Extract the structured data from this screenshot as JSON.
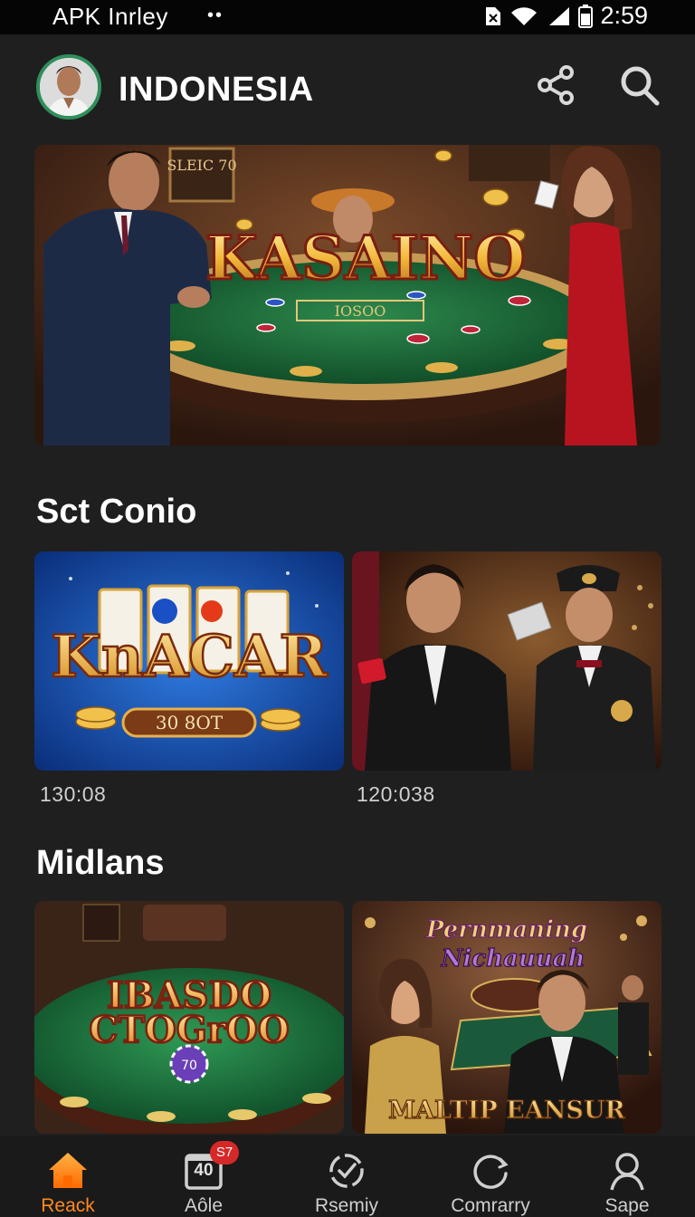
{
  "status_bar": {
    "app_label": "APK Inrley",
    "dots": "••",
    "time": "2:59",
    "icons": [
      "sim-icon",
      "wifi-icon",
      "signal-icon",
      "battery-icon"
    ]
  },
  "header": {
    "title": "INDONESIA",
    "icons": [
      "avatar",
      "share-icon",
      "search-icon"
    ]
  },
  "hero": {
    "logo_text": "KASAINO",
    "table_text": "IOSOO",
    "wall_sign": "SLEIC 70"
  },
  "sections": [
    {
      "title": "Sct Conio",
      "cards": [
        {
          "title_text": "KnACAR",
          "plaque": "30 8OT",
          "meta": "130:08"
        },
        {
          "meta": "120:038"
        }
      ]
    },
    {
      "title": "Midlans",
      "cards": [
        {
          "title_text_1": "IBASDO",
          "title_text_2": "CTOGrOO",
          "chip": "70"
        },
        {
          "script_1": "Pernmaning",
          "script_2": "Nichauuah",
          "banner": "MALTIP EANSUR"
        }
      ]
    }
  ],
  "bottom_nav": [
    {
      "label": "Reack",
      "icon": "home-icon",
      "active": true
    },
    {
      "label": "Aôle",
      "icon": "calendar-icon",
      "badge": "S7",
      "box_text": "40"
    },
    {
      "label": "Rsemiy",
      "icon": "check-circle-icon"
    },
    {
      "label": "Comrarry",
      "icon": "refresh-icon"
    },
    {
      "label": "Sape",
      "icon": "user-icon"
    }
  ],
  "colors": {
    "background": "#1f1f1f",
    "accent_active": "#ff8a1f",
    "badge": "#d62828",
    "avatar_ring": "#2f8f5b"
  }
}
